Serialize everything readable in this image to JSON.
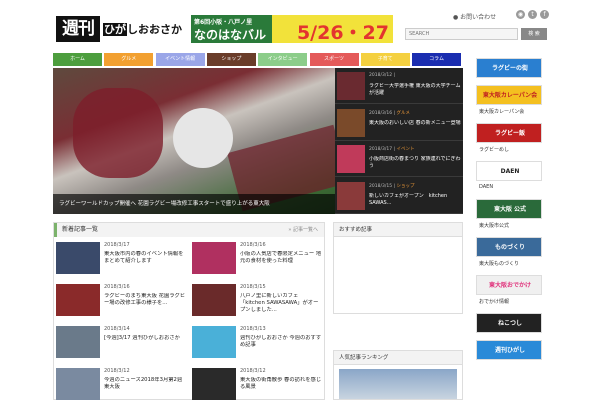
{
  "header": {
    "logo_kanji": "週刊",
    "logo_kana_hl": "ひが",
    "logo_kana": "しおおさか",
    "banner_small": "第6回小阪・八戸ノ里",
    "banner_title": "なのはなバル",
    "banner_date": "5/26・27",
    "top_link": "お問い合わせ",
    "social": [
      {
        "icon": "rss-icon",
        "glyph": "◉"
      },
      {
        "icon": "twitter-icon",
        "glyph": "t"
      },
      {
        "icon": "facebook-icon",
        "glyph": "f"
      }
    ],
    "search_placeholder": "SEARCH",
    "search_button": "検 索"
  },
  "nav": [
    {
      "label": "ホーム",
      "color": "#4d9e3e"
    },
    {
      "label": "グルメ",
      "color": "#f2a030"
    },
    {
      "label": "イベント情報",
      "color": "#9aa6e8"
    },
    {
      "label": "ショップ",
      "color": "#6a3d2a"
    },
    {
      "label": "インタビュー",
      "color": "#8ccd8a"
    },
    {
      "label": "スポーツ",
      "color": "#e45a5a"
    },
    {
      "label": "子育て",
      "color": "#f4d040"
    },
    {
      "label": "コラム",
      "color": "#1a2db0"
    }
  ],
  "hero": {
    "caption": "ラグビーワールドカップ開催へ 花園ラグビー場改修工事スタートで盛り上がる東大阪"
  },
  "hero_list": [
    {
      "date": "2018/3/12",
      "cat": "",
      "title": "ラグビー大学選手権 東大阪の大学チームが活躍",
      "thumb": "#6a2a30"
    },
    {
      "date": "2018/3/16",
      "cat": "グルメ",
      "title": "東大阪のおいしい店 春の新メニュー登場",
      "thumb": "#7a4a2a"
    },
    {
      "date": "2018/3/17",
      "cat": "イベント",
      "title": "小阪商店街の春まつり 家族連れでにぎわう",
      "thumb": "#c03a5a"
    },
    {
      "date": "2018/3/15",
      "cat": "ショップ",
      "title": "新しいカフェがオープン　kitchen SAWAS...",
      "thumb": "#8a3a3a"
    }
  ],
  "new_articles": {
    "title": "新着記事一覧",
    "more": "» 記事一覧へ",
    "items": [
      {
        "date": "2018/3/17",
        "title": "東大阪市内の春のイベント情報をまとめて紹介します",
        "thumb": "#3a4a6a"
      },
      {
        "date": "2018/3/16",
        "title": "小阪の人気店で春限定メニュー 地元の食材を使った料理",
        "thumb": "#b03060"
      },
      {
        "date": "2018/3/16",
        "title": "ラグビーのまち東大阪 花園ラグビー場の改修工事の様子を...",
        "thumb": "#8a2a2a"
      },
      {
        "date": "2018/3/15",
        "title": "八戸ノ里に新しいカフェ「kitchen SAWASAWA」がオープンしました...",
        "thumb": "#6a2a2a"
      },
      {
        "date": "2018/3/14",
        "title": "[今週]3/17 週刊ひがしおおさか",
        "thumb": "#6a7a8a"
      },
      {
        "date": "2018/3/13",
        "title": "週刊ひがしおおさか 今週のおすすめ記事",
        "thumb": "#4ab0d8"
      },
      {
        "date": "2018/3/12",
        "title": "今週のニュース2018年3月第2週 東大阪",
        "thumb": "#7a8aa0"
      },
      {
        "date": "2018/3/12",
        "title": "東大阪の街角散歩 春の訪れを感じる風景",
        "thumb": "#2a2a2a"
      }
    ]
  },
  "mid_boxes": [
    {
      "title": "おすすめ記事"
    },
    {
      "title": "人気記事ランキング"
    }
  ],
  "sidebar": {
    "banners": [
      {
        "text": "ラグビーの街",
        "bg": "#2a7fd0",
        "fg": "#ffffff",
        "label": ""
      },
      {
        "text": "東大阪カレーパン会",
        "bg": "#f4c020",
        "fg": "#c02020",
        "label": "東大阪カレーパン会"
      },
      {
        "text": "ラグビー飯",
        "bg": "#c02020",
        "fg": "#ffffff",
        "label": "ラグビーめし"
      },
      {
        "text": "DAEN",
        "bg": "#ffffff",
        "fg": "#222222",
        "label": "DAEN"
      },
      {
        "text": "東大阪 公式",
        "bg": "#2a6a3a",
        "fg": "#ffffff",
        "label": "東大阪市公式"
      },
      {
        "text": "ものづくり",
        "bg": "#3a6a9a",
        "fg": "#ffffff",
        "label": "東大阪ものづくり"
      },
      {
        "text": "東大阪おでかけ",
        "bg": "#f0f0f0",
        "fg": "#e0307a",
        "label": "おでかけ情報"
      },
      {
        "text": "ねこつし",
        "bg": "#222222",
        "fg": "#ffffff",
        "label": ""
      },
      {
        "text": "週刊ひがし",
        "bg": "#2a8ad8",
        "fg": "#ffffff",
        "label": ""
      }
    ]
  }
}
